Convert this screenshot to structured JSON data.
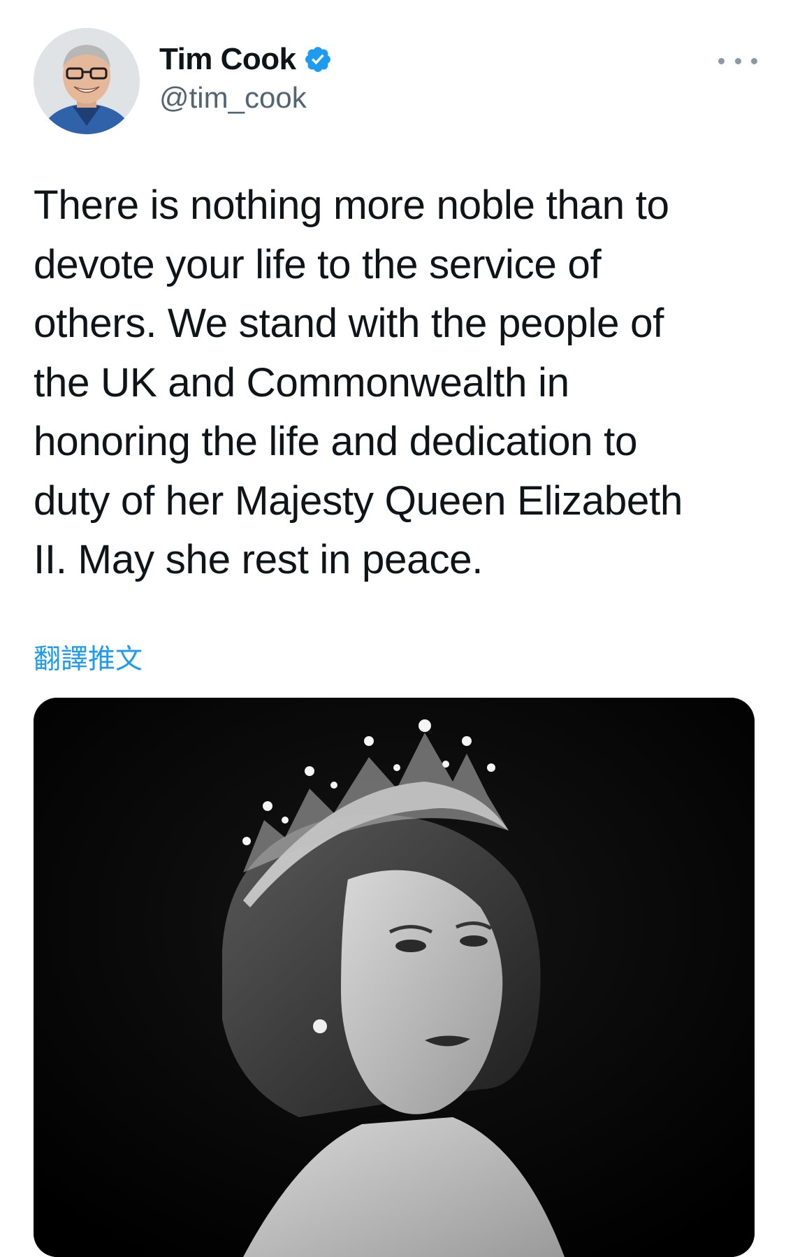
{
  "tweet": {
    "author": {
      "display_name": "Tim Cook",
      "handle": "@tim_cook",
      "verified": true,
      "avatar_icon": "profile-photo"
    },
    "more_icon": "more-horizontal-icon",
    "text": "There is nothing more noble than to\ndevote your life to the service of\nothers. We stand with the people of\nthe UK and Commonwealth in\nhonoring the life and dedication to\nduty of her Majesty Queen Elizabeth\nII. May she rest in peace.",
    "translate_label": "翻譯推文",
    "media": {
      "type": "photo",
      "icon": "portrait-photo"
    }
  },
  "colors": {
    "text": "#0f1419",
    "secondary": "#536471",
    "link": "#1d9bf0",
    "verified": "#1d9bf0"
  }
}
